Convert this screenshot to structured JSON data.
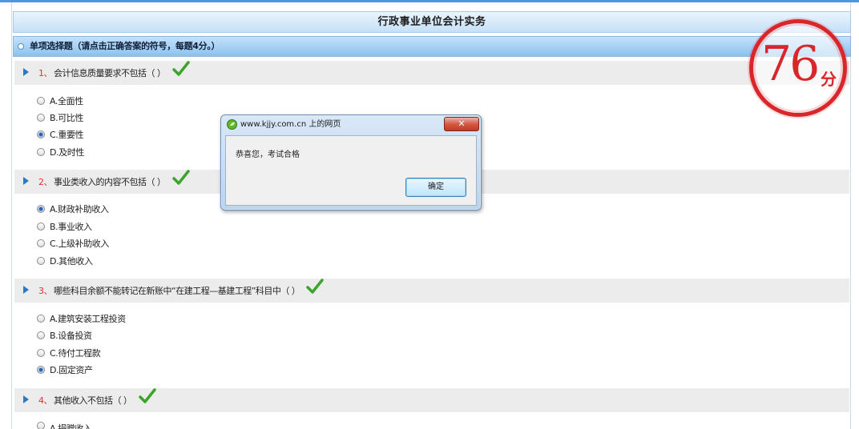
{
  "page": {
    "title": "行政事业单位会计实务"
  },
  "section": {
    "header": "单项选择题（请点击正确答案的符号，每题4分。）"
  },
  "questions": [
    {
      "number": "1、",
      "text": "会计信息质量要求不包括（ ）",
      "correct": true,
      "options": [
        {
          "label": "A.全面性",
          "selected": false
        },
        {
          "label": "B.可比性",
          "selected": false
        },
        {
          "label": "C.重要性",
          "selected": true
        },
        {
          "label": "D.及时性",
          "selected": false
        }
      ]
    },
    {
      "number": "2、",
      "text": "事业类收入的内容不包括（ ）",
      "correct": true,
      "options": [
        {
          "label": "A.财政补助收入",
          "selected": true
        },
        {
          "label": "B.事业收入",
          "selected": false
        },
        {
          "label": "C.上级补助收入",
          "selected": false
        },
        {
          "label": "D.其他收入",
          "selected": false
        }
      ]
    },
    {
      "number": "3、",
      "text": "哪些科目余额不能转记在新账中“在建工程—基建工程”科目中（ ）",
      "correct": true,
      "options": [
        {
          "label": "A.建筑安装工程投资",
          "selected": false
        },
        {
          "label": "B.设备投资",
          "selected": false
        },
        {
          "label": "C.待付工程款",
          "selected": false
        },
        {
          "label": "D.固定资产",
          "selected": true
        }
      ]
    },
    {
      "number": "4、",
      "text": "其他收入不包括（ ）",
      "correct": true,
      "options": [
        {
          "label": "A.捐赠收入",
          "selected": false
        }
      ]
    }
  ],
  "score": {
    "value": "76",
    "unit": "分"
  },
  "dialog": {
    "title": "www.kjjy.com.cn 上的网页",
    "message": "恭喜您，考试合格",
    "ok_label": "确定",
    "close_label": "✕"
  },
  "icons": {
    "question_marker": "triangle-right-icon",
    "correct": "check-icon",
    "dialog_app": "browser-leaf-icon"
  },
  "colors": {
    "accent": "#2a78cc",
    "header_blue": "#8dc1ec",
    "question_number": "#e03030",
    "check": "#3aa52a",
    "stamp": "#d8262b",
    "close_button": "#c23a22"
  }
}
